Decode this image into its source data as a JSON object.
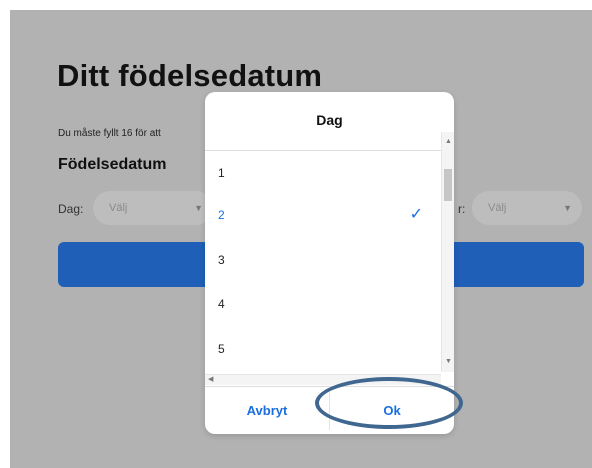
{
  "page": {
    "title": "Ditt födelsedatum",
    "subtitle": "Du måste fyllt 16 för att",
    "section_title": "Födelsedatum",
    "fields": {
      "day_label": "Dag:",
      "day_value": "Välj",
      "year_label": "r:",
      "year_value": "Välj"
    }
  },
  "dialog": {
    "title": "Dag",
    "items": [
      {
        "label": "1",
        "selected": false
      },
      {
        "label": "2",
        "selected": true
      },
      {
        "label": "3",
        "selected": false
      },
      {
        "label": "4",
        "selected": false
      },
      {
        "label": "5",
        "selected": false
      }
    ],
    "cancel_label": "Avbryt",
    "ok_label": "Ok"
  },
  "icons": {
    "check": "check-icon",
    "chevron": "chevron-down-icon"
  },
  "colors": {
    "accent": "#1a6fe0",
    "primary_bar": "#1f5fb8",
    "highlight": "#3f678f",
    "backdrop": "#b2b2b2"
  }
}
